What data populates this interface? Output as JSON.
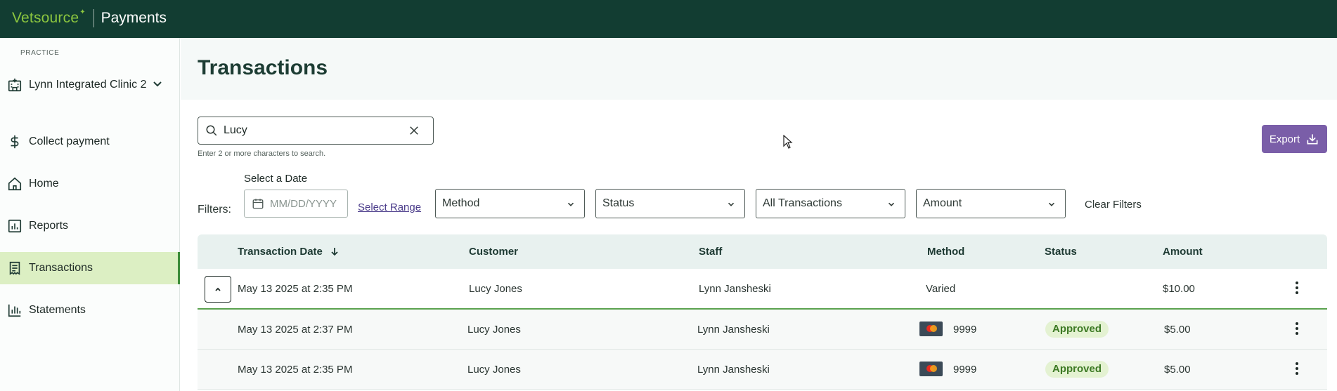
{
  "brand": {
    "name": "Vetsource",
    "spark": "✦",
    "product": "Payments"
  },
  "sidebar": {
    "practice_label": "PRACTICE",
    "practice_name": "Lynn Integrated Clinic 2",
    "items": [
      {
        "label": "Collect payment",
        "icon": "dollar-icon"
      },
      {
        "label": "Home",
        "icon": "home-icon"
      },
      {
        "label": "Reports",
        "icon": "reports-icon"
      },
      {
        "label": "Transactions",
        "icon": "receipt-icon",
        "active": true
      },
      {
        "label": "Statements",
        "icon": "bar-chart-icon"
      }
    ]
  },
  "main": {
    "title": "Transactions",
    "search": {
      "value": "Lucy",
      "hint": "Enter 2 or more characters to search."
    },
    "export_label": "Export",
    "filters": {
      "label": "Filters:",
      "date_label": "Select a Date",
      "date_placeholder": "MM/DD/YYYY",
      "select_range": "Select Range",
      "method": "Method",
      "status": "Status",
      "transactions": "All Transactions",
      "amount": "Amount",
      "clear": "Clear Filters"
    },
    "table": {
      "headers": {
        "date": "Transaction Date",
        "customer": "Customer",
        "staff": "Staff",
        "method": "Method",
        "status": "Status",
        "amount": "Amount"
      },
      "parent_row": {
        "date": "May 13 2025 at 2:35 PM",
        "customer": "Lucy Jones",
        "staff": "Lynn Jansheski",
        "method": "Varied",
        "amount": "$10.00"
      },
      "child_rows": [
        {
          "date": "May 13 2025 at 2:37 PM",
          "customer": "Lucy Jones",
          "staff": "Lynn Jansheski",
          "card_last4": "9999",
          "status": "Approved",
          "amount": "$5.00"
        },
        {
          "date": "May 13 2025 at 2:35 PM",
          "customer": "Lucy Jones",
          "staff": "Lynn Jansheski",
          "card_last4": "9999",
          "status": "Approved",
          "amount": "$5.00"
        }
      ]
    }
  },
  "colors": {
    "topbar": "#123d32",
    "brand_green": "#8cc63f",
    "active_nav": "#dcefc3",
    "export": "#7a5ea8",
    "approved_bg": "#e4f2d2"
  }
}
